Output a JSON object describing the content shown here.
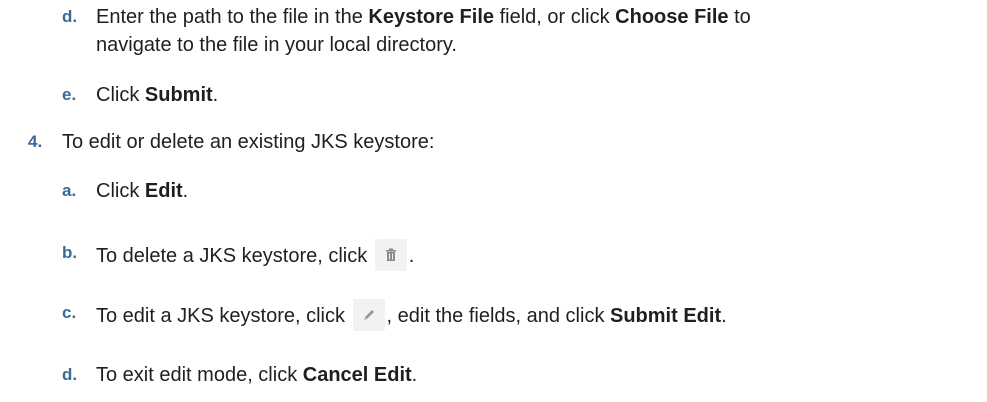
{
  "steps": [
    {
      "marker": "d.",
      "line1_pre": "Enter the path to the file in the ",
      "line1_bold1": "Keystore File",
      "line1_mid": " field, or click ",
      "line1_bold2": "Choose File",
      "line1_post": " to",
      "line2": "navigate to the file in your local directory."
    },
    {
      "marker": "e.",
      "pre": "Click ",
      "bold": "Submit",
      "post": "."
    },
    {
      "marker": "4.",
      "text": "To edit or delete an existing JKS keystore:"
    },
    {
      "marker": "a.",
      "pre": "Click ",
      "bold": "Edit",
      "post": "."
    },
    {
      "marker": "b.",
      "pre": "To delete a JKS keystore, click ",
      "post": ".",
      "icon": "trash-icon"
    },
    {
      "marker": "c.",
      "pre": "To edit a JKS keystore, click ",
      "mid": ", edit the fields, and click ",
      "bold": "Submit Edit",
      "post": ".",
      "icon": "pencil-icon"
    },
    {
      "marker": "d.",
      "pre": "To exit edit mode, click ",
      "bold": "Cancel Edit",
      "post": "."
    }
  ]
}
